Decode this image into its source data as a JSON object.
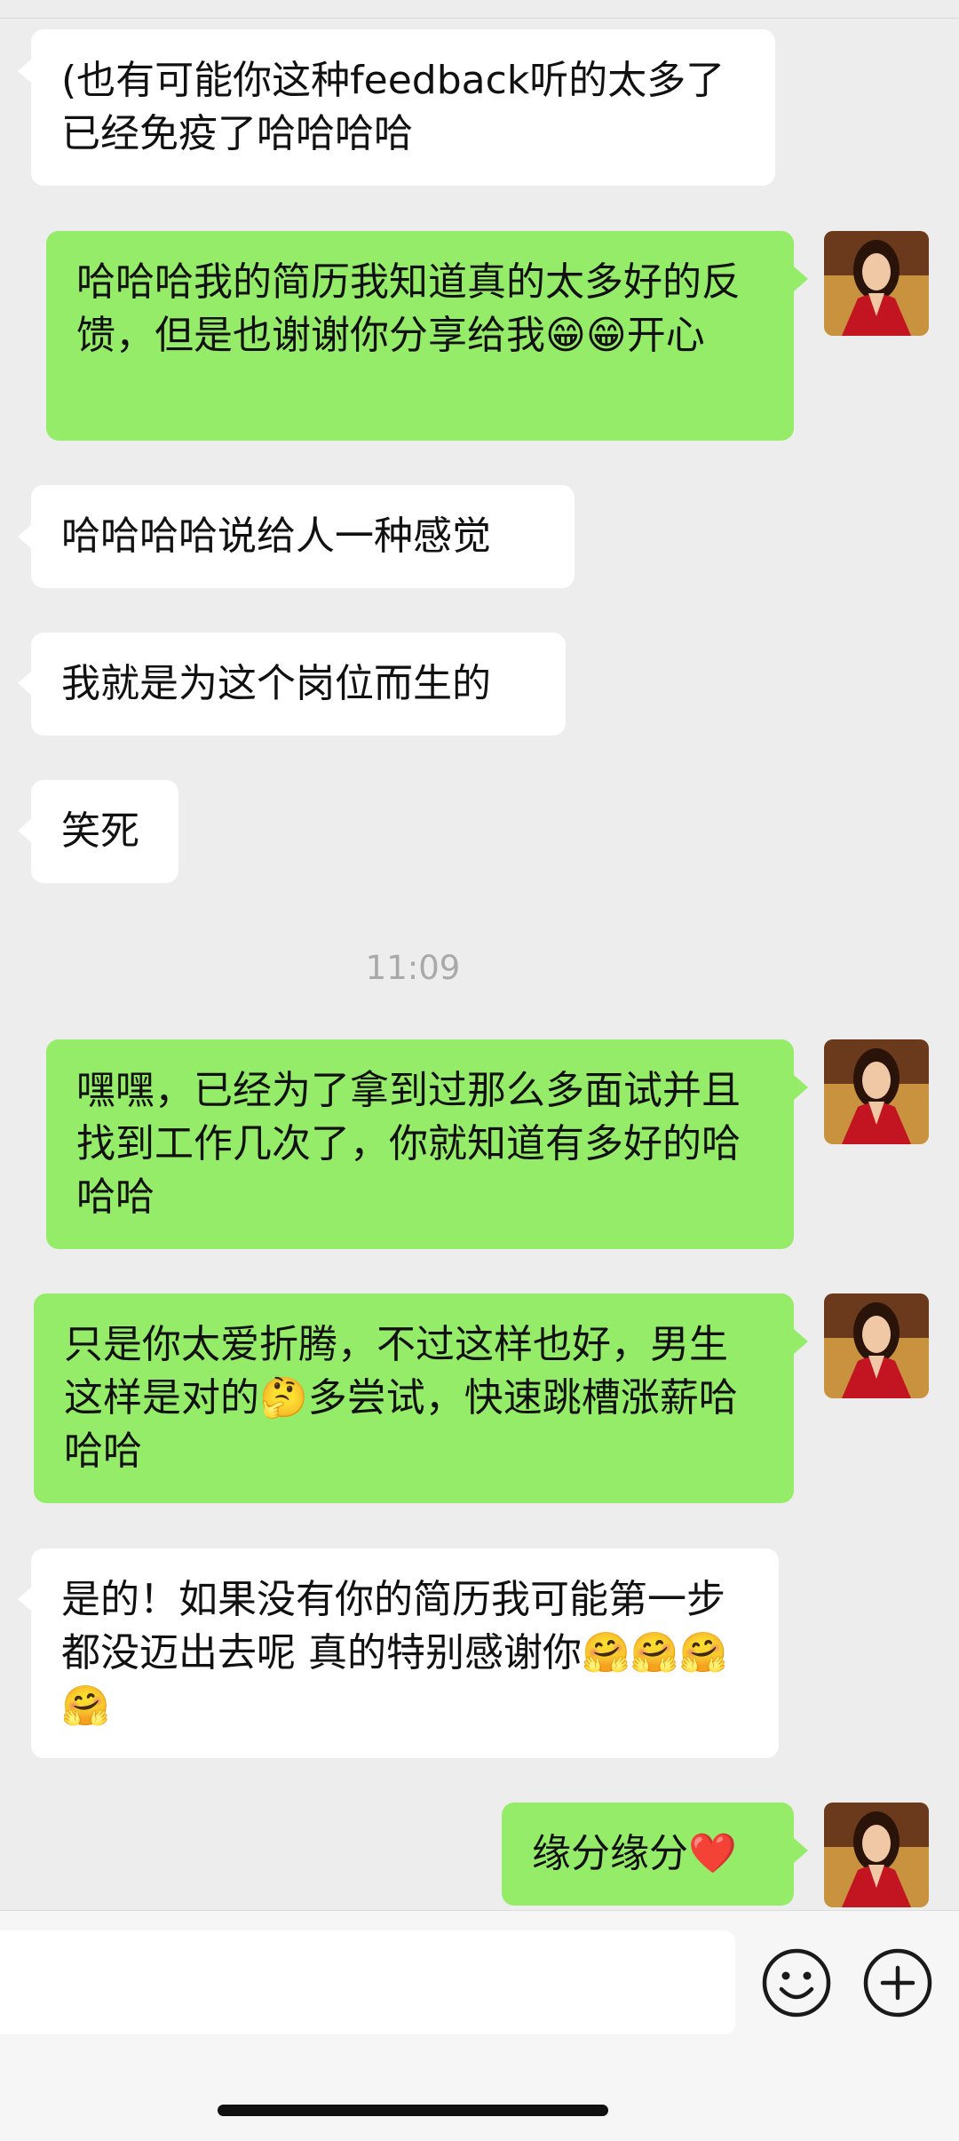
{
  "messages": [
    {
      "side": "in",
      "text": "(也有可能你这种feedback听的太多了已经免疫了哈哈哈哈"
    },
    {
      "side": "out",
      "text": "哈哈哈我的简历我知道真的太多好的反馈，但是也谢谢你分享给我😁😁开心"
    },
    {
      "side": "in",
      "text": "哈哈哈哈说给人一种感觉"
    },
    {
      "side": "in",
      "text": "我就是为这个岗位而生的"
    },
    {
      "side": "in",
      "text": "笑死"
    },
    {
      "side": "out",
      "text": "嘿嘿，已经为了拿到过那么多面试并且找到工作几次了，你就知道有多好的哈哈哈"
    },
    {
      "side": "out",
      "text": "只是你太爱折腾，不过这样也好，男生这样是对的🤔多尝试，快速跳槽涨薪哈哈哈"
    },
    {
      "side": "in",
      "text": "是的！如果没有你的简历我可能第一步都没迈出去呢 真的特别感谢你🤗🤗🤗🤗"
    },
    {
      "side": "out",
      "text": "缘分缘分❤️"
    }
  ],
  "timestamp": "11:09",
  "input": {
    "placeholder": ""
  },
  "icons": {
    "emoji_button": "smiley-icon",
    "plus_button": "plus-icon"
  },
  "colors": {
    "bg": "#ededed",
    "incoming": "#ffffff",
    "outgoing": "#95ec69"
  }
}
